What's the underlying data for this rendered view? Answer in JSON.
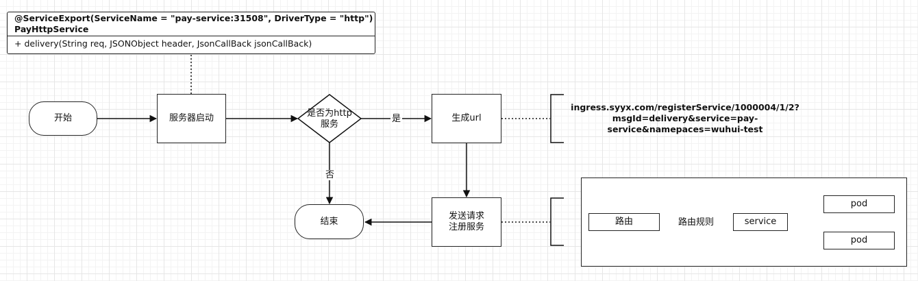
{
  "uml_class": {
    "annotation": "@ServiceExport(ServiceName = \"pay-service:31508\", DriverType = \"http\")",
    "class_name": "PayHttpService",
    "method": "+ delivery(String req, JSONObject header, JsonCallBack jsonCallBack)"
  },
  "flow": {
    "start": "开始",
    "boot": "服务器启动",
    "decision_line1": "是否为http",
    "decision_line2": "服务",
    "generate_url": "生成url",
    "send_request_line1": "发送请求",
    "send_request_line2": "注册服务",
    "end": "结束",
    "label_yes": "是",
    "label_no": "否"
  },
  "url_note": {
    "line1": "ingress.syyx.com/registerService/1000004/1/2?",
    "line2": "msgId=delivery&service=pay-",
    "line3": "service&namepaces=wuhui-test"
  },
  "routing": {
    "route": "路由",
    "route_rule": "路由规则",
    "service": "service",
    "pod_1": "pod",
    "pod_2": "pod"
  }
}
